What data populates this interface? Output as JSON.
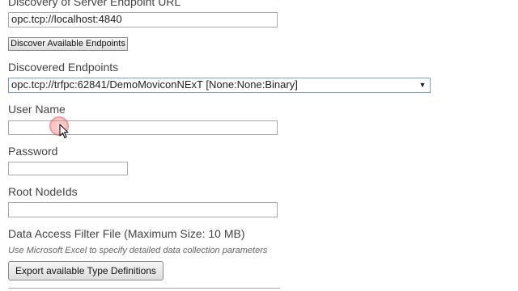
{
  "discovery": {
    "label": "Discovery of Server Endpoint URL",
    "url_value": "opc.tcp://localhost:4840",
    "discover_button": "Discover Available Endpoints"
  },
  "endpoints": {
    "label": "Discovered Endpoints",
    "selected": "opc.tcp://trfpc:62841/DemoMoviconNExT [None:None:Binary]"
  },
  "user": {
    "label": "User Name",
    "value": ""
  },
  "password": {
    "label": "Password",
    "value": ""
  },
  "root_nodeids": {
    "label": "Root NodeIds",
    "value": ""
  },
  "filter_file": {
    "label": "Data Access Filter File (Maximum Size: 10 MB)",
    "hint": "Use Microsoft Excel to specify detailed data collection parameters",
    "export_button": "Export available Type Definitions"
  }
}
